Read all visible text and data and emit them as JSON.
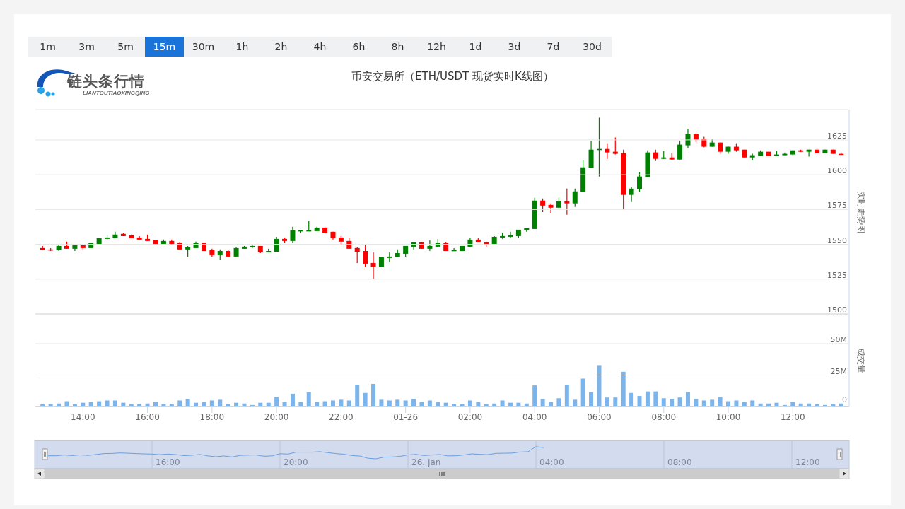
{
  "intervals": [
    {
      "label": "1m",
      "selected": false
    },
    {
      "label": "3m",
      "selected": false
    },
    {
      "label": "5m",
      "selected": false
    },
    {
      "label": "15m",
      "selected": true
    },
    {
      "label": "30m",
      "selected": false
    },
    {
      "label": "1h",
      "selected": false
    },
    {
      "label": "2h",
      "selected": false
    },
    {
      "label": "4h",
      "selected": false
    },
    {
      "label": "6h",
      "selected": false
    },
    {
      "label": "8h",
      "selected": false
    },
    {
      "label": "12h",
      "selected": false
    },
    {
      "label": "1d",
      "selected": false
    },
    {
      "label": "3d",
      "selected": false
    },
    {
      "label": "7d",
      "selected": false
    },
    {
      "label": "30d",
      "selected": false
    }
  ],
  "logo": {
    "name": "链头条行情",
    "subtitle": "LIANTOUTIAOXINGQING"
  },
  "title": "币安交易所（ETH/USDT 现货实时K线图）",
  "price_chart": {
    "chart_data": {
      "type": "candlestick",
      "ylabel": "实时走势图",
      "ylim": [
        1500,
        1646.8
      ],
      "yticks": [
        {
          "value": 1500,
          "label": "1500"
        },
        {
          "value": 1525,
          "label": "1525"
        },
        {
          "value": 1550,
          "label": "1550"
        },
        {
          "value": 1575,
          "label": "1575"
        },
        {
          "value": 1600,
          "label": "1600"
        },
        {
          "value": 1625,
          "label": "1625"
        }
      ],
      "categories": [
        null,
        null,
        null,
        null,
        null,
        null,
        null,
        null,
        null,
        null,
        null,
        null,
        null,
        null,
        null,
        null,
        null,
        null,
        null,
        null,
        null,
        null,
        null,
        null,
        null,
        null,
        null,
        null,
        null,
        null,
        null,
        null,
        null,
        null,
        null,
        null,
        null,
        null,
        null,
        null,
        null,
        null,
        null,
        null,
        null,
        null,
        null,
        null,
        null,
        null,
        null,
        null,
        null,
        null,
        null,
        null,
        null,
        null,
        null,
        null,
        null,
        null,
        null,
        null,
        null,
        null,
        null,
        null,
        null,
        null,
        null,
        null,
        null,
        null,
        null,
        null,
        null,
        null,
        null,
        null,
        null,
        null,
        null,
        null,
        null,
        null,
        null,
        null,
        null,
        null,
        null,
        null,
        null,
        null,
        null,
        null,
        null,
        null,
        null,
        null
      ],
      "ohlc": [
        [
          1547.3,
          1548.8,
          1545.9,
          1545.9
        ],
        [
          1546.3,
          1547.3,
          1545.2,
          1545.9
        ],
        [
          1545.9,
          1549.8,
          1545.2,
          1548.8
        ],
        [
          1548.8,
          1551.9,
          1546.8,
          1546.8
        ],
        [
          1546.8,
          1549.3,
          1545.2,
          1549.3
        ],
        [
          1549.3,
          1549.3,
          1546.3,
          1547.3
        ],
        [
          1547.3,
          1550.8,
          1547.3,
          1550.8
        ],
        [
          1550.2,
          1554.4,
          1550.2,
          1554.4
        ],
        [
          1553.9,
          1557.0,
          1552.9,
          1554.9
        ],
        [
          1554.4,
          1559.0,
          1554.4,
          1557.0
        ],
        [
          1557.5,
          1558.0,
          1555.9,
          1555.9
        ],
        [
          1556.5,
          1557.0,
          1554.4,
          1554.4
        ],
        [
          1554.9,
          1555.9,
          1553.4,
          1553.4
        ],
        [
          1553.9,
          1557.0,
          1552.4,
          1552.4
        ],
        [
          1552.9,
          1552.9,
          1549.8,
          1550.3
        ],
        [
          1550.3,
          1553.4,
          1550.3,
          1552.4
        ],
        [
          1552.4,
          1553.4,
          1549.8,
          1550.3
        ],
        [
          1550.8,
          1551.4,
          1546.3,
          1546.3
        ],
        [
          1546.3,
          1548.8,
          1540.7,
          1547.8
        ],
        [
          1547.3,
          1551.9,
          1547.3,
          1550.8
        ],
        [
          1550.8,
          1550.8,
          1545.2,
          1545.2
        ],
        [
          1545.8,
          1546.8,
          1541.2,
          1542.2
        ],
        [
          1542.2,
          1546.3,
          1538.6,
          1545.2
        ],
        [
          1545.2,
          1545.8,
          1541.2,
          1541.2
        ],
        [
          1541.2,
          1547.8,
          1541.2,
          1547.3
        ],
        [
          1546.8,
          1548.8,
          1546.8,
          1548.3
        ],
        [
          1547.8,
          1549.3,
          1547.3,
          1548.8
        ],
        [
          1548.8,
          1548.8,
          1543.7,
          1544.2
        ],
        [
          1544.2,
          1546.8,
          1544.2,
          1545.2
        ],
        [
          1544.7,
          1555.4,
          1544.7,
          1553.9
        ],
        [
          1553.9,
          1554.9,
          1550.8,
          1552.4
        ],
        [
          1552.4,
          1562.6,
          1550.8,
          1560.0
        ],
        [
          1559.5,
          1560.5,
          1558.0,
          1560.0
        ],
        [
          1559.7,
          1566.6,
          1559.7,
          1560.0
        ],
        [
          1559.5,
          1562.6,
          1559.5,
          1562.0
        ],
        [
          1562.0,
          1562.6,
          1557.5,
          1558.0
        ],
        [
          1559.0,
          1559.0,
          1553.4,
          1554.4
        ],
        [
          1554.9,
          1556.0,
          1550.3,
          1551.9
        ],
        [
          1552.4,
          1554.9,
          1546.8,
          1546.8
        ],
        [
          1547.3,
          1548.3,
          1536.6,
          1544.7
        ],
        [
          1545.2,
          1549.3,
          1533.5,
          1536.1
        ],
        [
          1536.6,
          1544.2,
          1524.9,
          1534.0
        ],
        [
          1534.0,
          1540.7,
          1533.5,
          1540.7
        ],
        [
          1540.2,
          1544.2,
          1537.1,
          1541.2
        ],
        [
          1540.7,
          1546.3,
          1540.7,
          1543.7
        ],
        [
          1543.2,
          1548.8,
          1541.2,
          1548.8
        ],
        [
          1548.3,
          1551.4,
          1546.3,
          1551.4
        ],
        [
          1551.4,
          1551.4,
          1546.8,
          1546.8
        ],
        [
          1546.8,
          1552.9,
          1545.2,
          1548.8
        ],
        [
          1548.3,
          1553.9,
          1548.3,
          1550.8
        ],
        [
          1550.8,
          1551.4,
          1545.2,
          1545.2
        ],
        [
          1545.5,
          1547.3,
          1545.5,
          1545.8
        ],
        [
          1545.2,
          1548.8,
          1545.2,
          1548.8
        ],
        [
          1548.3,
          1554.9,
          1547.8,
          1553.4
        ],
        [
          1553.4,
          1554.4,
          1551.4,
          1551.4
        ],
        [
          1551.4,
          1551.9,
          1548.3,
          1550.3
        ],
        [
          1550.3,
          1555.9,
          1550.3,
          1555.4
        ],
        [
          1554.9,
          1558.5,
          1553.9,
          1555.9
        ],
        [
          1555.4,
          1559.0,
          1554.4,
          1556.5
        ],
        [
          1555.9,
          1560.5,
          1554.4,
          1560.5
        ],
        [
          1560.0,
          1562.0,
          1559.0,
          1561.5
        ],
        [
          1561.0,
          1583.4,
          1561.0,
          1581.4
        ],
        [
          1581.4,
          1582.9,
          1573.2,
          1577.8
        ],
        [
          1578.3,
          1579.4,
          1572.2,
          1576.3
        ],
        [
          1576.3,
          1583.4,
          1575.8,
          1580.9
        ],
        [
          1580.9,
          1590.0,
          1571.2,
          1579.4
        ],
        [
          1579.4,
          1590.0,
          1576.8,
          1588.0
        ],
        [
          1587.5,
          1610.4,
          1587.5,
          1605.3
        ],
        [
          1604.8,
          1624.2,
          1604.8,
          1618.0
        ],
        [
          1617.7,
          1641.0,
          1598.7,
          1618.5
        ],
        [
          1618.5,
          1622.6,
          1611.4,
          1616.0
        ],
        [
          1616.5,
          1626.7,
          1614.5,
          1615.0
        ],
        [
          1615.5,
          1618.0,
          1574.8,
          1585.5
        ],
        [
          1585.5,
          1591.1,
          1580.4,
          1590.0
        ],
        [
          1589.5,
          1601.8,
          1587.5,
          1598.7
        ],
        [
          1598.2,
          1617.5,
          1598.2,
          1616.0
        ],
        [
          1616.0,
          1618.0,
          1609.9,
          1611.4
        ],
        [
          1611.4,
          1617.0,
          1611.4,
          1612.4
        ],
        [
          1612.4,
          1615.5,
          1610.9,
          1610.9
        ],
        [
          1610.9,
          1624.2,
          1610.9,
          1621.6
        ],
        [
          1621.1,
          1632.8,
          1619.1,
          1629.2
        ],
        [
          1629.2,
          1629.8,
          1623.6,
          1625.2
        ],
        [
          1625.7,
          1627.2,
          1619.6,
          1620.1
        ],
        [
          1620.1,
          1625.7,
          1620.1,
          1623.1
        ],
        [
          1623.1,
          1623.1,
          1615.0,
          1616.5
        ],
        [
          1616.5,
          1620.1,
          1615.0,
          1620.1
        ],
        [
          1620.1,
          1622.6,
          1616.5,
          1617.5
        ],
        [
          1618.0,
          1618.0,
          1612.4,
          1612.4
        ],
        [
          1612.4,
          1615.0,
          1610.4,
          1614.0
        ],
        [
          1613.5,
          1617.5,
          1613.5,
          1616.5
        ],
        [
          1616.5,
          1616.5,
          1613.5,
          1613.5
        ],
        [
          1613.5,
          1617.0,
          1613.5,
          1614.5
        ],
        [
          1614.0,
          1616.0,
          1614.0,
          1615.0
        ],
        [
          1614.5,
          1617.5,
          1614.0,
          1617.5
        ],
        [
          1617.5,
          1618.0,
          1616.5,
          1616.5
        ],
        [
          1616.5,
          1618.0,
          1613.0,
          1618.0
        ],
        [
          1618.0,
          1619.1,
          1615.5,
          1615.5
        ],
        [
          1615.5,
          1618.0,
          1615.5,
          1618.0
        ],
        [
          1618.0,
          1618.0,
          1615.0,
          1615.0
        ],
        [
          1615.0,
          1616.0,
          1614.7,
          1614.7
        ]
      ]
    }
  },
  "volume_chart": {
    "chart_data": {
      "type": "bar",
      "ylabel": "成交量",
      "ylim": [
        0,
        73.6
      ],
      "yticks": [
        {
          "value": 0,
          "label": "0"
        },
        {
          "value": 25,
          "label": "25M"
        },
        {
          "value": 50,
          "label": "50M"
        }
      ],
      "categories": [
        null,
        null,
        null,
        null,
        null,
        "14:00",
        null,
        null,
        null,
        null,
        null,
        null,
        null,
        "16:00",
        null,
        null,
        null,
        null,
        null,
        null,
        null,
        "18:00",
        null,
        null,
        null,
        null,
        null,
        null,
        null,
        "20:00",
        null,
        null,
        null,
        null,
        null,
        null,
        null,
        "22:00",
        null,
        null,
        null,
        null,
        null,
        null,
        null,
        "01-26",
        null,
        null,
        null,
        null,
        null,
        null,
        null,
        "02:00",
        null,
        null,
        null,
        null,
        null,
        null,
        null,
        "04:00",
        null,
        null,
        null,
        null,
        null,
        null,
        null,
        "06:00",
        null,
        null,
        null,
        null,
        null,
        null,
        null,
        "08:00",
        null,
        null,
        null,
        null,
        null,
        null,
        null,
        "10:00",
        null,
        null,
        null,
        null,
        null,
        null,
        null,
        "12:00",
        null,
        null,
        null,
        null,
        null,
        null
      ],
      "values": [
        1.8,
        1.8,
        2.4,
        4.2,
        1.8,
        3.0,
        3.6,
        4.2,
        4.8,
        4.8,
        3.0,
        1.8,
        1.8,
        2.4,
        3.6,
        1.8,
        1.8,
        4.8,
        6.0,
        3.0,
        3.6,
        4.8,
        5.4,
        1.8,
        3.0,
        2.4,
        1.2,
        3.0,
        3.0,
        7.8,
        3.6,
        10.2,
        3.6,
        11.4,
        3.6,
        4.2,
        4.8,
        5.4,
        4.8,
        17.4,
        10.8,
        18.0,
        5.4,
        4.8,
        5.4,
        4.8,
        6.0,
        3.6,
        4.8,
        3.6,
        3.0,
        1.8,
        1.8,
        4.8,
        3.6,
        1.8,
        2.4,
        4.8,
        3.0,
        3.0,
        2.4,
        16.8,
        6.0,
        3.6,
        6.6,
        17.4,
        5.4,
        22.2,
        11.4,
        32.4,
        7.2,
        7.2,
        27.6,
        10.8,
        8.4,
        12.0,
        12.0,
        6.6,
        6.0,
        7.2,
        11.4,
        6.0,
        4.8,
        5.4,
        7.8,
        4.2,
        4.8,
        3.6,
        4.8,
        2.4,
        2.4,
        3.0,
        1.2,
        3.6,
        2.4,
        2.4,
        1.8,
        1.2,
        1.8,
        2.4
      ]
    }
  },
  "navigator": {
    "labels": [
      "16:00",
      "20:00",
      "26. Jan",
      "04:00",
      "08:00",
      "12:00"
    ]
  }
}
